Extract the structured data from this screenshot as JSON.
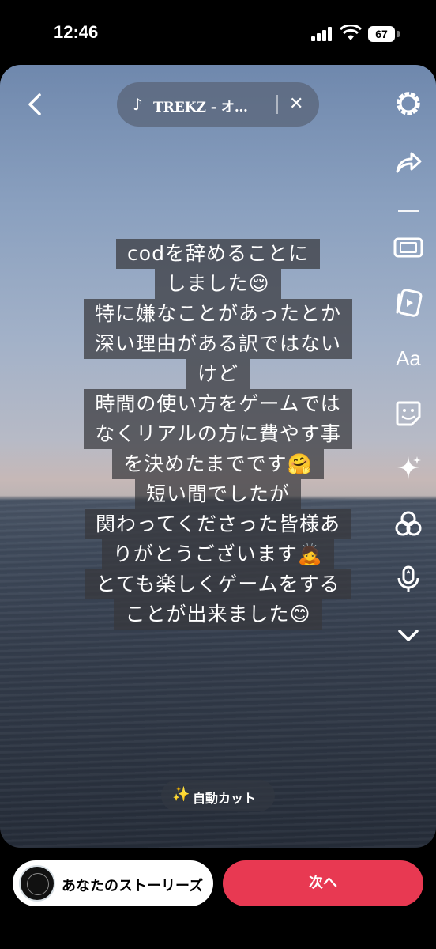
{
  "status_bar": {
    "time": "12:46",
    "battery": "67"
  },
  "music": {
    "note": "♪",
    "title": "TREKZ - オ…",
    "close": "✕"
  },
  "tools": [
    "settings-icon",
    "share-icon",
    "aspect-ratio-icon",
    "media-icon",
    "text-icon",
    "sticker-icon",
    "effects-icon",
    "filters-icon",
    "voice-icon",
    "chevron-down-icon"
  ],
  "text_tool_label": "Aa",
  "caption_lines": [
    "codを辞めることに",
    "しました😌",
    "特に嫌なことがあったとか",
    "深い理由がある訳ではない",
    "けど",
    "時間の使い方をゲームでは",
    "なくリアルの方に費やす事",
    "を決めたまでです🤗",
    "短い間でしたが",
    "関わってくださった皆様あ",
    "りがとうございます🙇",
    "とても楽しくゲームをする",
    "ことが出来ました😊"
  ],
  "auto_cut": {
    "icon": "✨",
    "label": "自動カット"
  },
  "bottom": {
    "story_label": "あなたのストーリーズ",
    "next_label": "次へ"
  },
  "colors": {
    "accent": "#e83952"
  }
}
